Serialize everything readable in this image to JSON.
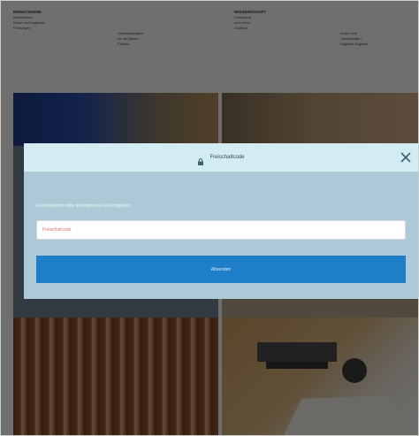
{
  "background": {
    "columns": [
      {
        "heading": "ERWACHSENE",
        "lines": [
          "Bibliotheken",
          "Kurse und Angebote",
          "Führungen"
        ]
      },
      {
        "heading": "",
        "lines": [
          "Veranstaltungen",
          "für die ganze",
          "Familie"
        ]
      },
      {
        "heading": "WISSENSCHAFT",
        "lines": [
          "Forschung",
          "und Lehre",
          "Studium"
        ]
      },
      {
        "heading": "",
        "lines": [
          "Archiv und",
          "Sammlungen",
          "Digitales Angebot"
        ]
      }
    ]
  },
  "modal": {
    "title": "Freischaltcode",
    "lock_icon": "lock-icon",
    "close_icon": "close-icon",
    "instruction": "Freischaltcode bitte im folgenden Feld eingeben",
    "input_placeholder": "Freischaltcode",
    "input_value": "",
    "submit_label": "Absenden",
    "colors": {
      "header_bg": "#d3ecf2",
      "body_bg": "#adc8d7",
      "button_bg": "#1e7ec8"
    }
  }
}
